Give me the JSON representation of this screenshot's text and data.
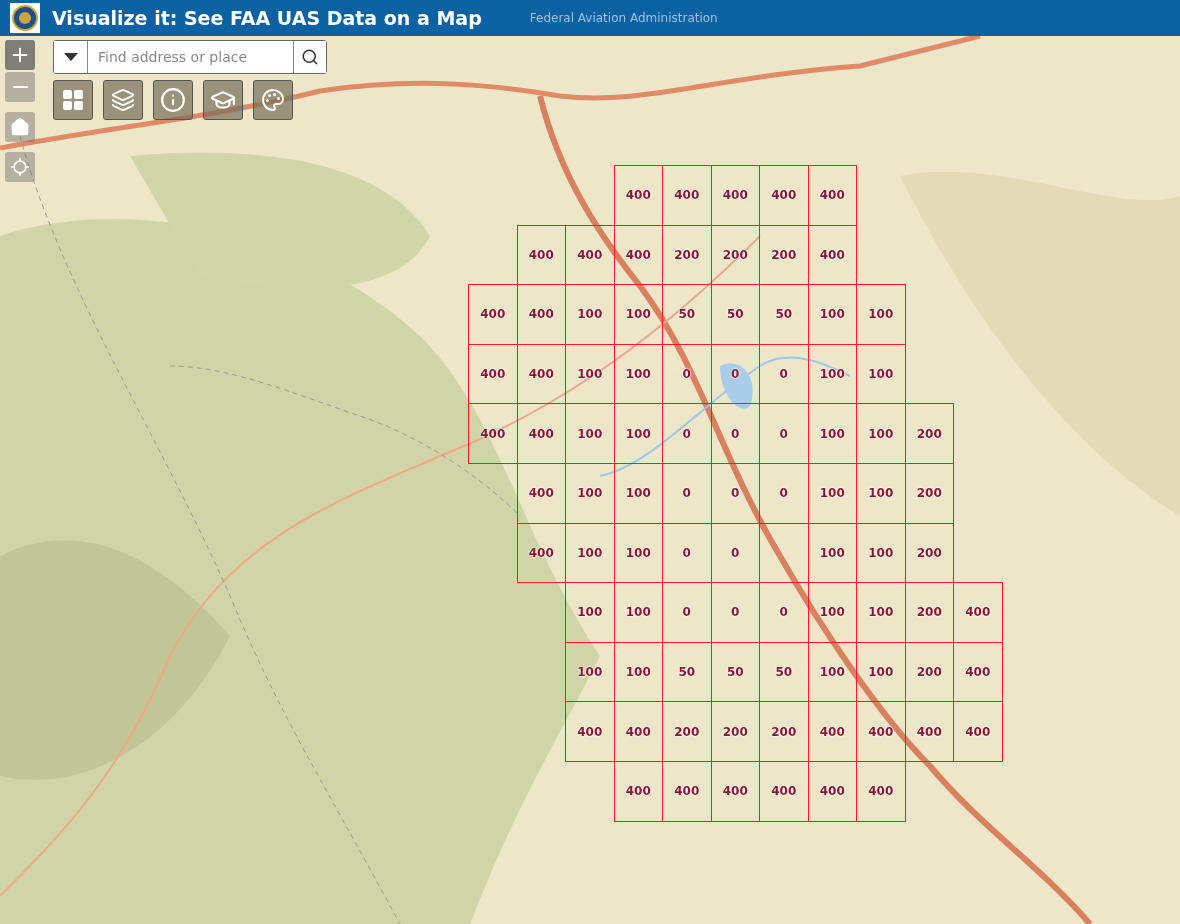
{
  "header": {
    "title": "Visualize it: See FAA UAS Data on a Map",
    "subtitle": "Federal Aviation Administration"
  },
  "search": {
    "placeholder": "Find address or place"
  },
  "grid": {
    "rows": [
      {
        "cells": [
          "400",
          "400",
          "400",
          "400",
          "400"
        ]
      },
      {
        "cells": [
          "400",
          "400",
          "400",
          "200",
          "200",
          "200",
          "400"
        ]
      },
      {
        "cells": [
          "400",
          "400",
          "100",
          "100",
          "50",
          "50",
          "50",
          "100",
          "100"
        ]
      },
      {
        "cells": [
          "400",
          "400",
          "100",
          "100",
          "0",
          "0",
          "0",
          "100",
          "100"
        ]
      },
      {
        "cells": [
          "400",
          "400",
          "100",
          "100",
          "0",
          "0",
          "0",
          "100",
          "100",
          "200"
        ]
      },
      {
        "cells": [
          "400",
          "100",
          "100",
          "0",
          "0",
          "0",
          "100",
          "100",
          "200"
        ]
      },
      {
        "cells": [
          "400",
          "100",
          "100",
          "0",
          "0",
          null,
          "100",
          "100",
          "200"
        ]
      },
      {
        "cells": [
          "100",
          "100",
          "0",
          "0",
          "0",
          "100",
          "100",
          "200",
          "400"
        ]
      },
      {
        "cells": [
          "100",
          "100",
          "50",
          "50",
          "50",
          "100",
          "100",
          "200",
          "400"
        ]
      },
      {
        "cells": [
          "400",
          "400",
          "200",
          "200",
          "200",
          "400",
          "400",
          "400",
          "400"
        ]
      },
      {
        "cells": [
          "400",
          "400",
          "400",
          "400",
          "400",
          "400"
        ]
      }
    ]
  }
}
